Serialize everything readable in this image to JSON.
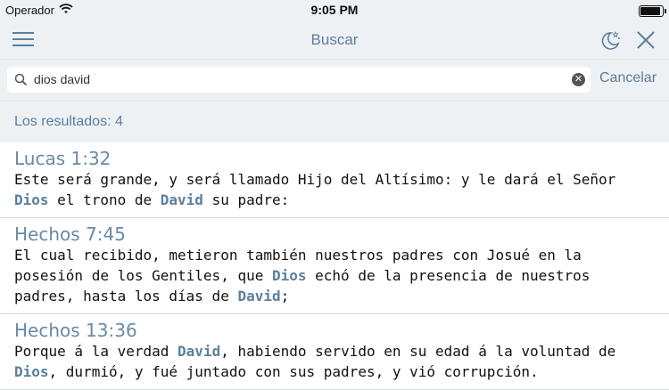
{
  "status": {
    "carrier": "Operador",
    "time": "9:05 PM",
    "battery_level": 0.92
  },
  "nav": {
    "title": "Buscar",
    "icons": {
      "menu": "hamburger-menu-icon",
      "night": "night-mode-icon",
      "close": "close-icon"
    }
  },
  "search": {
    "query": "dios david",
    "cancel_label": "Cancelar",
    "icons": {
      "search": "search-icon",
      "clear": "clear-icon"
    }
  },
  "results_header": "Los resultados: 4",
  "results": [
    {
      "reference": "Lucas 1:32",
      "parts": [
        {
          "t": "Este será grande, y será llamado Hijo del Altísimo: y le dará el Señor "
        },
        {
          "t": "Dios",
          "h": true
        },
        {
          "t": " el trono de "
        },
        {
          "t": "David",
          "h": true
        },
        {
          "t": " su padre:"
        }
      ]
    },
    {
      "reference": "Hechos 7:45",
      "parts": [
        {
          "t": "El cual recibido, metieron también nuestros padres con Josué en la posesión de los Gentiles, que "
        },
        {
          "t": "Dios",
          "h": true
        },
        {
          "t": " echó de la presencia de nuestros padres, hasta los días de "
        },
        {
          "t": "David",
          "h": true
        },
        {
          "t": ";"
        }
      ]
    },
    {
      "reference": "Hechos 13:36",
      "parts": [
        {
          "t": "Porque á la verdad "
        },
        {
          "t": "David",
          "h": true
        },
        {
          "t": ", habiendo servido en su edad á la voluntad de "
        },
        {
          "t": "Dios",
          "h": true
        },
        {
          "t": ", durmió, y fué juntado con sus padres, y vió corrupción."
        }
      ]
    }
  ],
  "colors": {
    "accent": "#5a7f9e",
    "bar_bg": "#eef1f4"
  }
}
